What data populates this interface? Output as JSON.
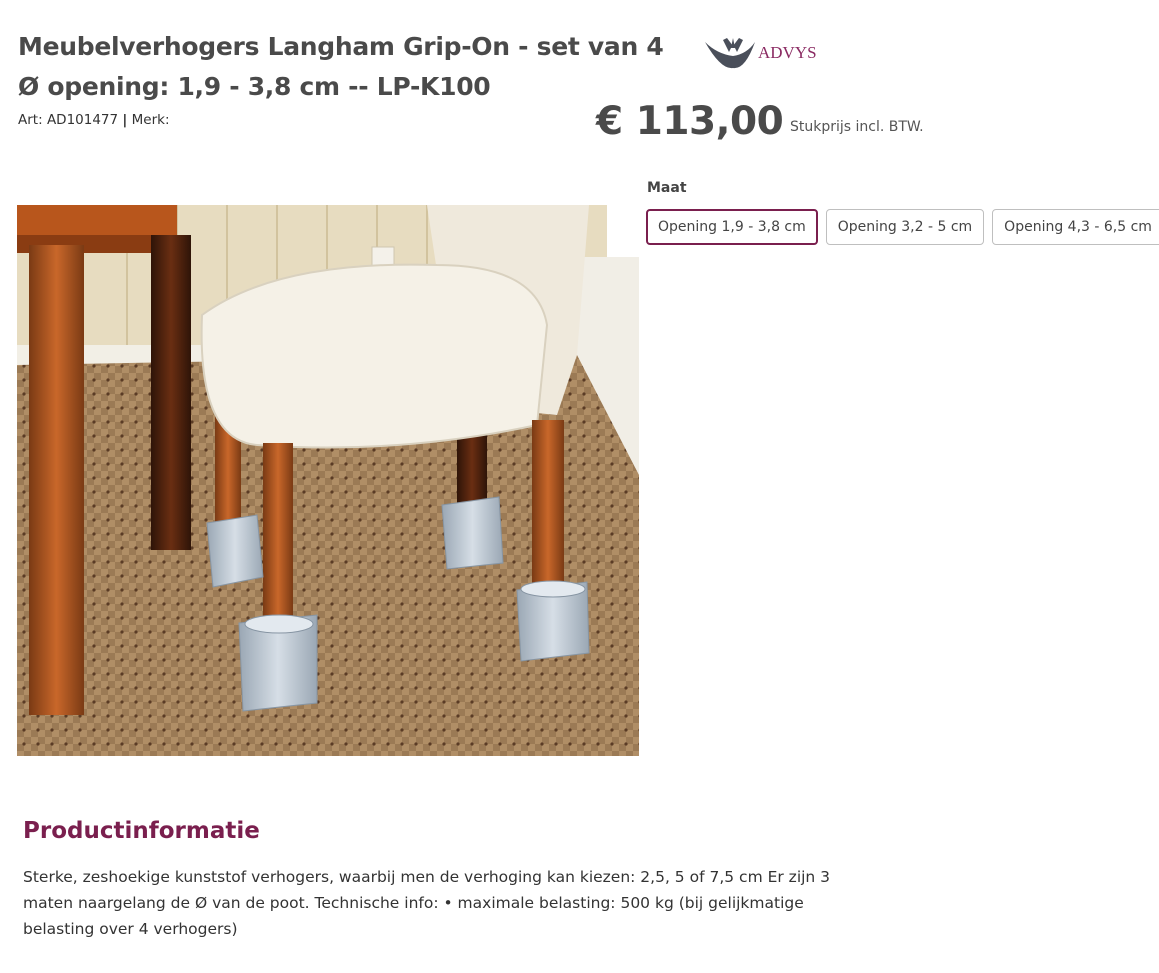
{
  "product": {
    "title": "Meubelverhogers Langham Grip-On - set van 4 Ø opening: 1,9 - 3,8 cm -- LP-K100",
    "art_label": "Art:",
    "art_number": "AD101477",
    "separator": "|",
    "brand_label": "Merk:",
    "brand_logo_text": "ADVYS"
  },
  "pricing": {
    "price": "€ 113,00",
    "note": "Stukprijs incl. BTW."
  },
  "size_selector": {
    "label": "Maat",
    "options": [
      {
        "label": "Opening 1,9 - 3,8 cm",
        "selected": true
      },
      {
        "label": "Opening 3,2 - 5 cm",
        "selected": false
      },
      {
        "label": "Opening 4,3 - 6,5 cm",
        "selected": false
      }
    ]
  },
  "info": {
    "heading": "Productinformatie",
    "text": "Sterke, zeshoekige kunststof verhogers, waarbij men de verhoging kan kiezen: 2,5, 5 of 7,5 cm Er zijn 3 maten naargelang de Ø van de poot. Technische info: • maximale belasting: 500 kg (bij gelijkmatige belasting over 4 verhogers)"
  },
  "colors": {
    "accent": "#7a1f4e",
    "text": "#4a4a4a"
  }
}
